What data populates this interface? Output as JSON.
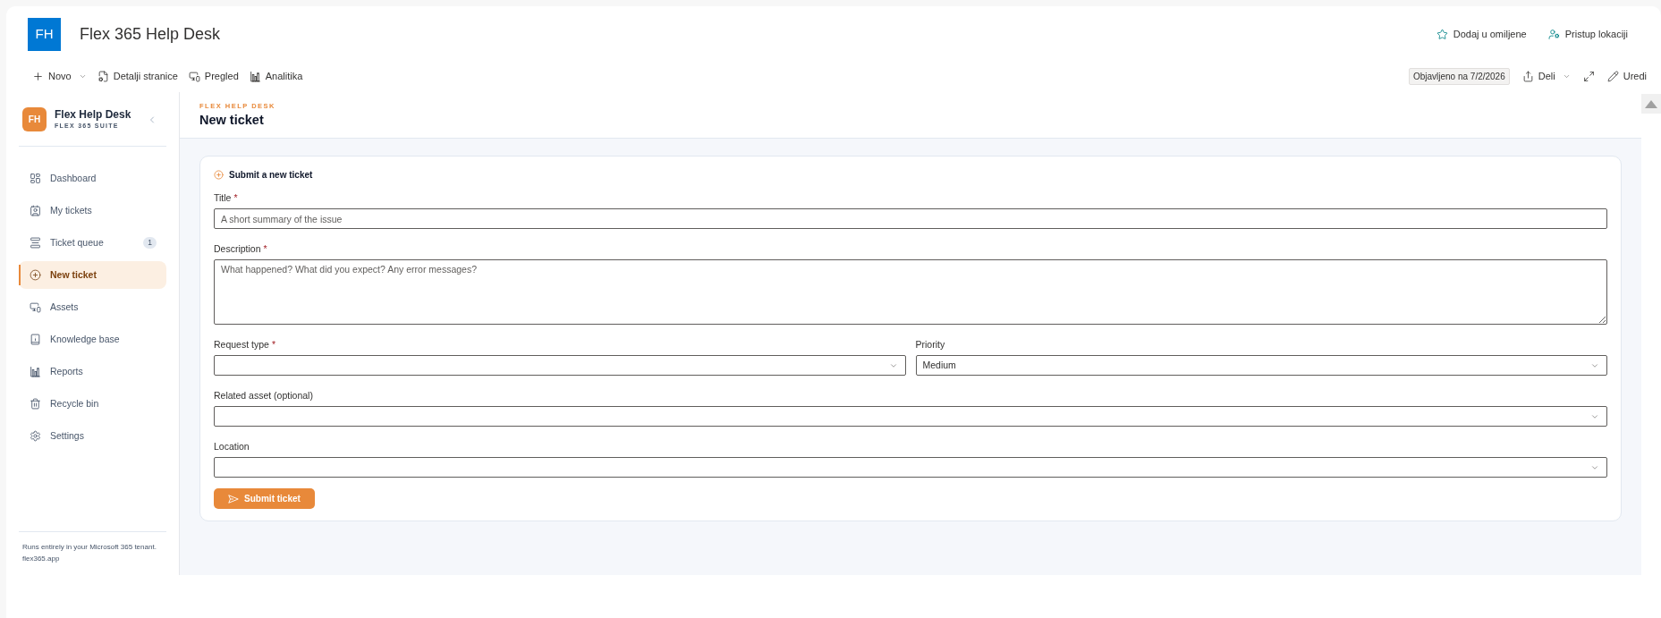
{
  "site": {
    "logo": "FH",
    "title": "Flex 365 Help Desk",
    "actions": [
      {
        "kind": "favorite",
        "label": "Dodaj u omiljene"
      },
      {
        "kind": "site_access",
        "label": "Pristup lokaciji"
      }
    ]
  },
  "command_bar": {
    "items": [
      {
        "kind": "new",
        "label": "Novo",
        "has_menu": true
      },
      {
        "kind": "page_details",
        "label": "Detalji stranice",
        "has_menu": false
      },
      {
        "kind": "preview",
        "label": "Pregled",
        "has_menu": false
      },
      {
        "kind": "analytics",
        "label": "Analitika",
        "has_menu": false
      }
    ],
    "status": "Objavljeno na 7/2/2026",
    "tools": [
      {
        "kind": "share",
        "label": "Deli",
        "has_menu": true
      },
      {
        "kind": "expand",
        "has_menu": false
      },
      {
        "kind": "edit",
        "label": "Uredi",
        "has_menu": false
      }
    ]
  },
  "sidebar": {
    "logo": "FH",
    "app_name": "Flex Help Desk",
    "suite": "FLEX 365 SUITE",
    "items": [
      {
        "kind": "dashboard",
        "label": "Dashboard",
        "selected": false
      },
      {
        "kind": "my_tickets",
        "label": "My tickets",
        "selected": false
      },
      {
        "kind": "queue",
        "label": "Ticket queue",
        "badge": "1",
        "selected": false
      },
      {
        "kind": "new_ticket",
        "label": "New ticket",
        "selected": true
      },
      {
        "kind": "assets",
        "label": "Assets",
        "selected": false
      },
      {
        "kind": "knowledge",
        "label": "Knowledge base",
        "selected": false
      },
      {
        "kind": "reports",
        "label": "Reports",
        "selected": false
      },
      {
        "kind": "recycle",
        "label": "Recycle bin",
        "selected": false
      },
      {
        "kind": "settings",
        "label": "Settings",
        "selected": false
      }
    ],
    "footer": [
      "Runs entirely in your Microsoft 365 tenant.",
      "flex365.app"
    ]
  },
  "page_header": {
    "eyebrow": "FLEX HELP DESK",
    "title": "New ticket"
  },
  "form": {
    "heading": "Submit a new ticket",
    "required_mark": "*",
    "rows": [
      [
        {
          "kind": "text",
          "label": "Title",
          "required": true,
          "placeholder": "A short summary of the issue"
        }
      ],
      [
        {
          "kind": "textarea",
          "label": "Description",
          "required": true,
          "placeholder": "What happened? What did you expect? Any error messages?"
        }
      ],
      [
        {
          "kind": "select",
          "label": "Request type",
          "required": true
        },
        {
          "kind": "select",
          "label": "Priority",
          "required": false,
          "value": "Medium"
        }
      ],
      [
        {
          "kind": "select",
          "label": "Related asset (optional)",
          "required": false
        }
      ],
      [
        {
          "kind": "select",
          "label": "Location",
          "required": false
        }
      ]
    ],
    "submit": "Submit ticket"
  }
}
